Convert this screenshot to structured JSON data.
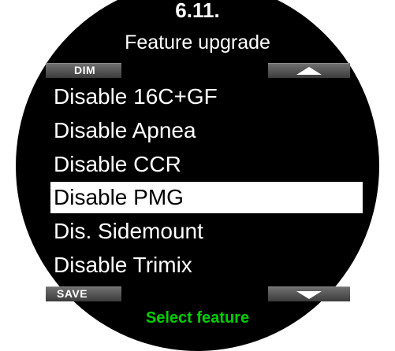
{
  "header": {
    "number": "6.11.",
    "title": "Feature upgrade"
  },
  "softkeys": {
    "top_left": "DIM",
    "top_right_icon": "arrow-up-icon",
    "bottom_left": "SAVE",
    "bottom_right_icon": "arrow-down-icon"
  },
  "menu": {
    "items": [
      {
        "label": "Disable 16C+GF",
        "selected": false
      },
      {
        "label": "Disable Apnea",
        "selected": false
      },
      {
        "label": "Disable CCR",
        "selected": false
      },
      {
        "label": "Disable PMG",
        "selected": true
      },
      {
        "label": "Dis. Sidemount",
        "selected": false
      },
      {
        "label": "Disable Trimix",
        "selected": false
      }
    ]
  },
  "status": {
    "text": "Select feature",
    "color": "#00d000"
  },
  "colors": {
    "background": "#000000",
    "text": "#ffffff",
    "highlight": "#ffffff",
    "accent": "#00d000"
  }
}
